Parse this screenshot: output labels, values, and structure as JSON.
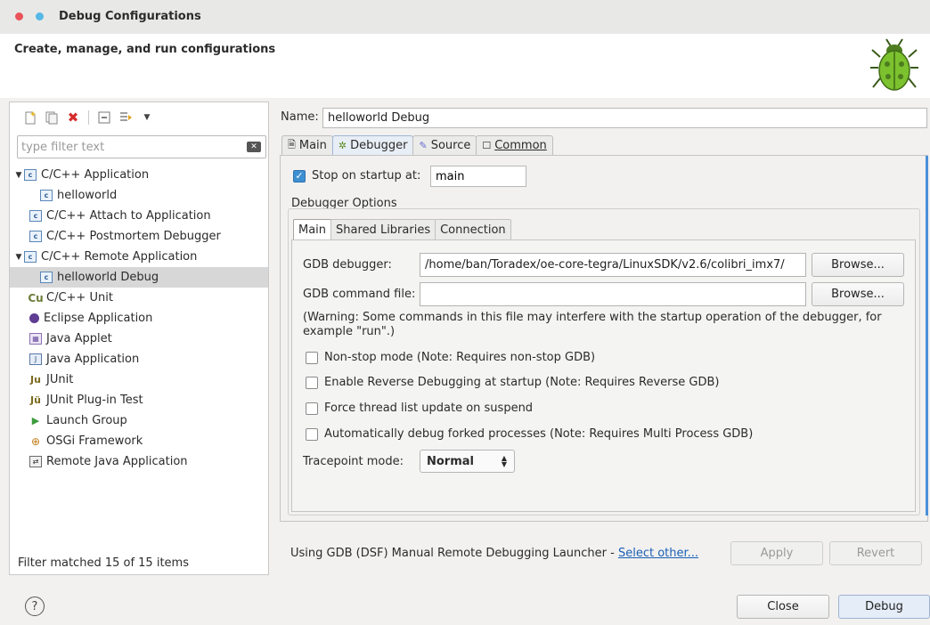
{
  "window": {
    "title": "Debug Configurations"
  },
  "header": {
    "title": "Create, manage, and run configurations",
    "logo_icon": "bug-icon"
  },
  "left_toolbar": {
    "icons": [
      "new-configuration-icon",
      "duplicate-icon",
      "delete-icon",
      "collapse-all-icon",
      "filter-icon",
      "view-menu-icon"
    ]
  },
  "filter": {
    "placeholder": "type filter text",
    "value": ""
  },
  "tree": {
    "items": [
      {
        "label": "C/C++ Application",
        "icon": "c-app-icon"
      },
      {
        "label": "helloworld",
        "icon": "c-app-icon"
      },
      {
        "label": "C/C++ Attach to Application",
        "icon": "c-app-icon"
      },
      {
        "label": "C/C++ Postmortem Debugger",
        "icon": "c-app-icon"
      },
      {
        "label": "C/C++ Remote Application",
        "icon": "c-app-icon"
      },
      {
        "label": "helloworld Debug",
        "icon": "c-app-icon"
      },
      {
        "label": "C/C++ Unit",
        "icon": "c-unit-icon"
      },
      {
        "label": "Eclipse Application",
        "icon": "eclipse-icon"
      },
      {
        "label": "Java Applet",
        "icon": "java-applet-icon"
      },
      {
        "label": "Java Application",
        "icon": "java-application-icon"
      },
      {
        "label": "JUnit",
        "icon": "junit-icon"
      },
      {
        "label": "JUnit Plug-in Test",
        "icon": "junit-plugin-icon"
      },
      {
        "label": "Launch Group",
        "icon": "launch-group-icon"
      },
      {
        "label": "OSGi Framework",
        "icon": "osgi-icon"
      },
      {
        "label": "Remote Java Application",
        "icon": "remote-java-icon"
      }
    ]
  },
  "filter_status": "Filter matched 15 of 15 items",
  "config": {
    "name_label": "Name:",
    "name_value": "helloworld Debug",
    "tabs": [
      {
        "label": "Main",
        "icon": "main-tab-icon"
      },
      {
        "label": "Debugger",
        "icon": "debugger-tab-icon"
      },
      {
        "label": "Source",
        "icon": "source-tab-icon"
      },
      {
        "label": "Common",
        "icon": "common-tab-icon"
      }
    ],
    "active_tab": "Debugger"
  },
  "debugger": {
    "stop_on_startup_label": "Stop on startup at:",
    "stop_on_startup_checked": true,
    "stop_on_startup_value": "main",
    "options_label": "Debugger Options",
    "subtabs": [
      "Main",
      "Shared Libraries",
      "Connection"
    ],
    "active_subtab": "Main",
    "gdb_debugger_label": "GDB debugger:",
    "gdb_debugger_value": "/home/ban/Toradex/oe-core-tegra/LinuxSDK/v2.6/colibri_imx7/",
    "gdb_command_file_label": "GDB command file:",
    "gdb_command_file_value": "",
    "browse_label": "Browse...",
    "warning": "(Warning: Some commands in this file may interfere with the startup operation of the debugger, for example \"run\".)",
    "checkboxes": [
      {
        "label": "Non-stop mode (Note: Requires non-stop GDB)",
        "checked": false
      },
      {
        "label": "Enable Reverse Debugging at startup (Note: Requires Reverse GDB)",
        "checked": false
      },
      {
        "label": "Force thread list update on suspend",
        "checked": false
      },
      {
        "label": "Automatically debug forked processes (Note: Requires Multi Process GDB)",
        "checked": false
      }
    ],
    "tracepoint_label": "Tracepoint mode:",
    "tracepoint_value": "Normal"
  },
  "launcher": {
    "text": "Using GDB (DSF) Manual Remote Debugging Launcher - ",
    "link": "Select other..."
  },
  "buttons": {
    "apply": "Apply",
    "revert": "Revert",
    "close": "Close",
    "debug": "Debug"
  },
  "colors": {
    "accent": "#3d8fd1",
    "link": "#1a5fb4",
    "selection": "#d7d7d7"
  }
}
